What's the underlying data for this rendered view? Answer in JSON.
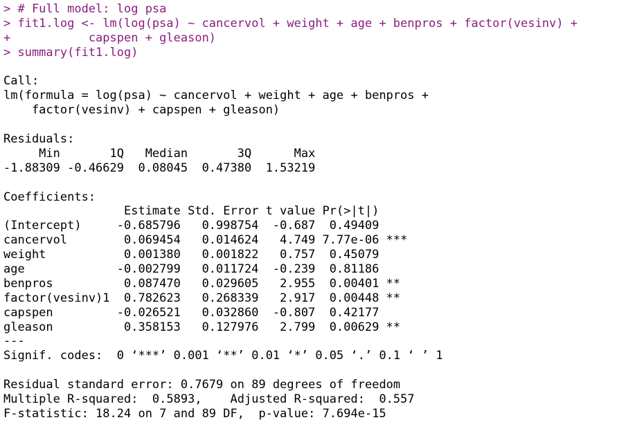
{
  "console": {
    "lines": [
      {
        "text": "> # Full model: log psa",
        "kind": "cmd"
      },
      {
        "text": "> fit1.log <- lm(log(psa) ~ cancervol + weight + age + benpros + factor(vesinv) +",
        "kind": "cmd"
      },
      {
        "text": "+           capspen + gleason)",
        "kind": "cmd"
      },
      {
        "text": "> summary(fit1.log)",
        "kind": "cmd"
      },
      {
        "text": "",
        "kind": "out"
      },
      {
        "text": "Call:",
        "kind": "out"
      },
      {
        "text": "lm(formula = log(psa) ~ cancervol + weight + age + benpros +",
        "kind": "out"
      },
      {
        "text": "    factor(vesinv) + capspen + gleason)",
        "kind": "out"
      },
      {
        "text": "",
        "kind": "out"
      },
      {
        "text": "Residuals:",
        "kind": "out"
      },
      {
        "text": "     Min       1Q   Median       3Q      Max ",
        "kind": "out"
      },
      {
        "text": "-1.88309 -0.46629  0.08045  0.47380  1.53219 ",
        "kind": "out"
      },
      {
        "text": "",
        "kind": "out"
      },
      {
        "text": "Coefficients:",
        "kind": "out"
      },
      {
        "text": "                 Estimate Std. Error t value Pr(>|t|)    ",
        "kind": "out"
      },
      {
        "text": "(Intercept)     -0.685796   0.998754  -0.687  0.49409    ",
        "kind": "out"
      },
      {
        "text": "cancervol        0.069454   0.014624   4.749 7.77e-06 ***",
        "kind": "out"
      },
      {
        "text": "weight           0.001380   0.001822   0.757  0.45079    ",
        "kind": "out"
      },
      {
        "text": "age             -0.002799   0.011724  -0.239  0.81186    ",
        "kind": "out"
      },
      {
        "text": "benpros          0.087470   0.029605   2.955  0.00401 ** ",
        "kind": "out"
      },
      {
        "text": "factor(vesinv)1  0.782623   0.268339   2.917  0.00448 ** ",
        "kind": "out"
      },
      {
        "text": "capspen         -0.026521   0.032860  -0.807  0.42177    ",
        "kind": "out"
      },
      {
        "text": "gleason          0.358153   0.127976   2.799  0.00629 ** ",
        "kind": "out"
      },
      {
        "text": "---",
        "kind": "out"
      },
      {
        "text": "Signif. codes:  0 ‘***’ 0.001 ‘**’ 0.01 ‘*’ 0.05 ‘.’ 0.1 ‘ ’ 1",
        "kind": "out"
      },
      {
        "text": "",
        "kind": "out"
      },
      {
        "text": "Residual standard error: 0.7679 on 89 degrees of freedom",
        "kind": "out"
      },
      {
        "text": "Multiple R-squared:  0.5893,\tAdjusted R-squared:  0.557 ",
        "kind": "out"
      },
      {
        "text": "F-statistic: 18.24 on 7 and 89 DF,  p-value: 7.694e-15",
        "kind": "out"
      }
    ]
  },
  "colors": {
    "command": "#8b1c7f",
    "output": "#000000",
    "background": "#ffffff"
  }
}
